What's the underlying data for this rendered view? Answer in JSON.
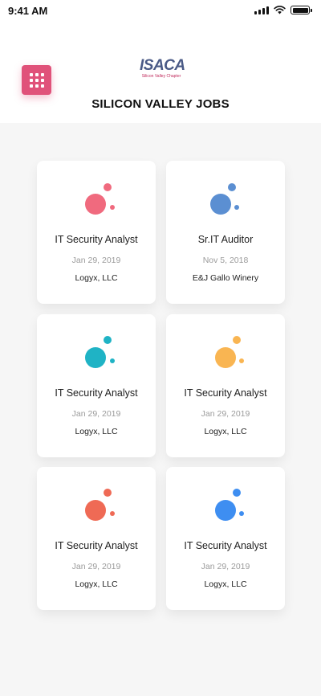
{
  "status_bar": {
    "time": "9:41 AM"
  },
  "header": {
    "logo_text": "ISACA",
    "logo_subtext": "Silicon Valley Chapter",
    "title": "SILICON VALLEY JOBS"
  },
  "jobs": [
    {
      "title": "IT Security Analyst",
      "date": "Jan 29, 2019",
      "company": "Logyx, LLC",
      "color": "#f06a7e"
    },
    {
      "title": "Sr.IT Auditor",
      "date": "Nov 5, 2018",
      "company": "E&J Gallo Winery",
      "color": "#5b8fd2"
    },
    {
      "title": "IT Security Analyst",
      "date": "Jan 29, 2019",
      "company": "Logyx, LLC",
      "color": "#1fb3c5"
    },
    {
      "title": "IT Security Analyst",
      "date": "Jan 29, 2019",
      "company": "Logyx, LLC",
      "color": "#f9b552"
    },
    {
      "title": "IT Security Analyst",
      "date": "Jan 29, 2019",
      "company": "Logyx, LLC",
      "color": "#ef6a55"
    },
    {
      "title": "IT Security Analyst",
      "date": "Jan 29, 2019",
      "company": "Logyx, LLC",
      "color": "#3e8ef1"
    }
  ]
}
